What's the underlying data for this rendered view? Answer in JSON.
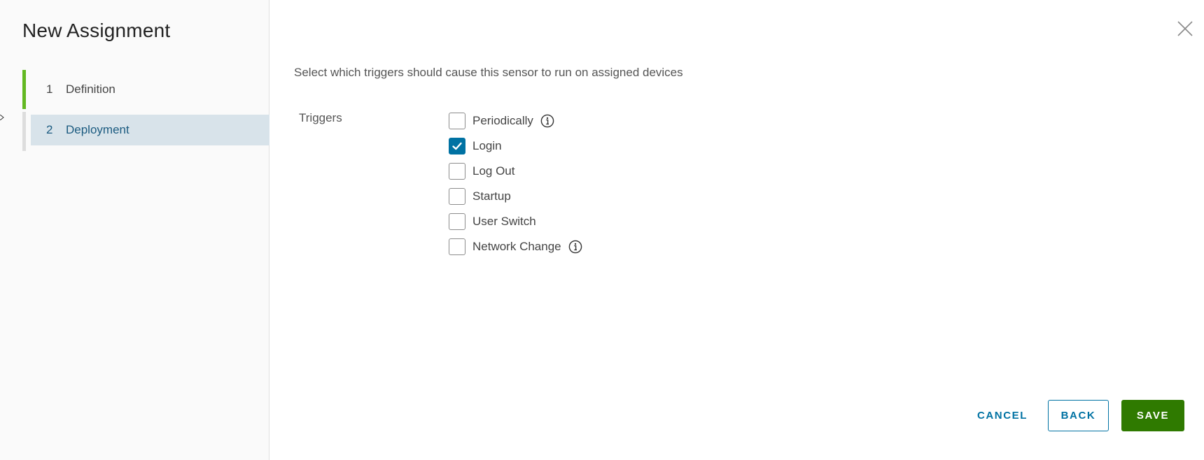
{
  "modal": {
    "title": "New Assignment"
  },
  "steps": [
    {
      "number": "1",
      "label": "Definition",
      "state": "complete"
    },
    {
      "number": "2",
      "label": "Deployment",
      "state": "active"
    }
  ],
  "main": {
    "instructions": "Select which triggers should cause this sensor to run on assigned devices",
    "triggers_label": "Triggers",
    "triggers": [
      {
        "label": "Periodically",
        "checked": false,
        "has_info": true
      },
      {
        "label": "Login",
        "checked": true,
        "has_info": false
      },
      {
        "label": "Log Out",
        "checked": false,
        "has_info": false
      },
      {
        "label": "Startup",
        "checked": false,
        "has_info": false
      },
      {
        "label": "User Switch",
        "checked": false,
        "has_info": false
      },
      {
        "label": "Network Change",
        "checked": false,
        "has_info": true
      }
    ]
  },
  "footer": {
    "cancel_label": "CANCEL",
    "back_label": "BACK",
    "save_label": "SAVE"
  },
  "icons": {
    "close": "close-icon",
    "info": "info-icon",
    "check": "checkmark-icon"
  },
  "colors": {
    "accent_blue": "#0072a3",
    "save_green": "#2f7a00",
    "step_complete_green": "#62b821",
    "active_step_bg": "#d8e3ea"
  }
}
